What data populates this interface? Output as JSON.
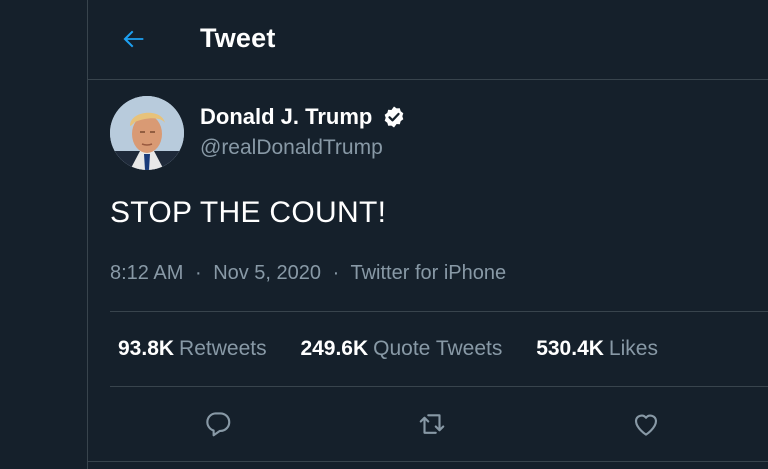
{
  "header": {
    "back_icon": "arrow-left-icon",
    "title": "Tweet"
  },
  "tweet": {
    "author": {
      "display_name": "Donald J. Trump",
      "handle": "@realDonaldTrump",
      "verified_icon": "verified-badge-icon"
    },
    "text": "STOP THE COUNT!",
    "time": "8:12 AM",
    "date": "Nov 5, 2020",
    "separator": "·",
    "source": "Twitter for iPhone"
  },
  "stats": {
    "retweets": {
      "count": "93.8K",
      "label": "Retweets"
    },
    "quote_tweets": {
      "count": "249.6K",
      "label": "Quote Tweets"
    },
    "likes": {
      "count": "530.4K",
      "label": "Likes"
    }
  },
  "actions": [
    "reply-icon",
    "retweet-icon",
    "like-icon"
  ],
  "colors": {
    "background": "#15202b",
    "border": "#38444d",
    "accent": "#1da1f2",
    "secondary_text": "#8899a6",
    "primary_text": "#ffffff"
  }
}
